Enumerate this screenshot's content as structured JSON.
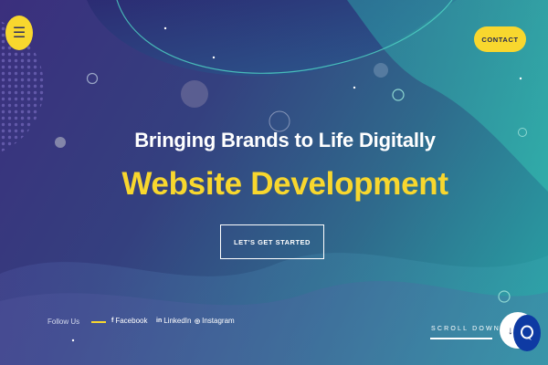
{
  "header": {
    "menu_icon": "☰",
    "contact_label": "CONTACT"
  },
  "hero": {
    "heading": "Bringing Brands to Life Digitally",
    "subheading": "Website Development",
    "cta_label": "LET'S GET STARTED"
  },
  "footer": {
    "follow_label": "Follow Us",
    "socials": [
      {
        "icon": "f",
        "label": "Facebook"
      },
      {
        "icon": "in",
        "label": "LinkedIn"
      },
      {
        "icon": "◎",
        "label": "Instagram"
      }
    ],
    "scroll_label": "SCROLL DOWN",
    "scroll_icon": "↓"
  },
  "colors": {
    "accent": "#f8d72e",
    "bg_start": "#3b2f7d",
    "bg_end": "#27a7a6",
    "chat": "#0e3aa3"
  },
  "icons": [
    "menu-icon",
    "facebook-icon",
    "linkedin-icon",
    "instagram-icon",
    "arrow-down-icon",
    "chat-icon"
  ]
}
